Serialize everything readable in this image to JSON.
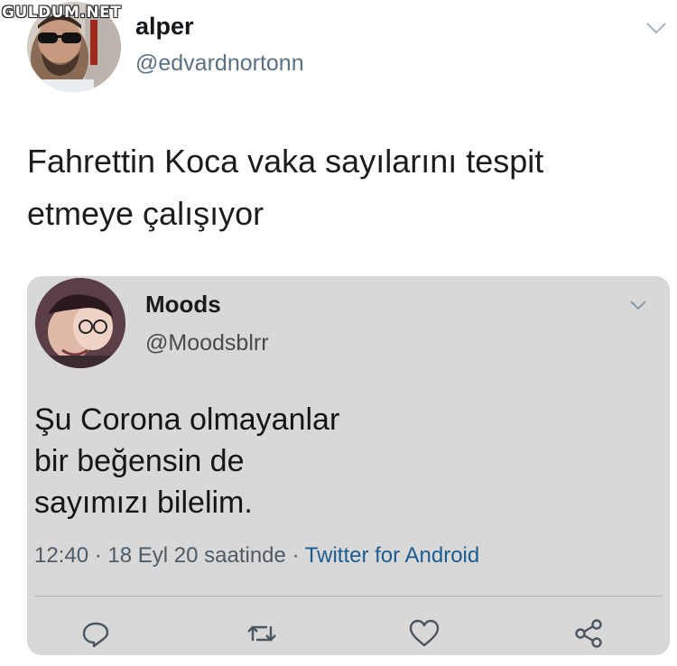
{
  "watermark": "GULDUM.NET",
  "tweet": {
    "display_name": "alper",
    "handle": "@edvardnortonn",
    "text": "Fahrettin Koca vaka sayılarını tespit\netmeye çalışıyor"
  },
  "quoted_tweet": {
    "display_name": "Moods",
    "handle": "@Moodsblrr",
    "text": "Şu Corona olmayanlar\nbir beğensin de\nsayımızı bilelim.",
    "time": "12:40",
    "date_text": "18 Eyl 20 saatinde",
    "separator": "·",
    "source": "Twitter for Android"
  },
  "icons": {
    "options": "chevron-down-icon",
    "reply": "reply-icon",
    "retweet": "retweet-icon",
    "like": "heart-icon",
    "share": "share-icon"
  },
  "colors": {
    "handle": "#5b7083",
    "card_background": "#d8d8d8",
    "link": "#1d5c8f"
  }
}
